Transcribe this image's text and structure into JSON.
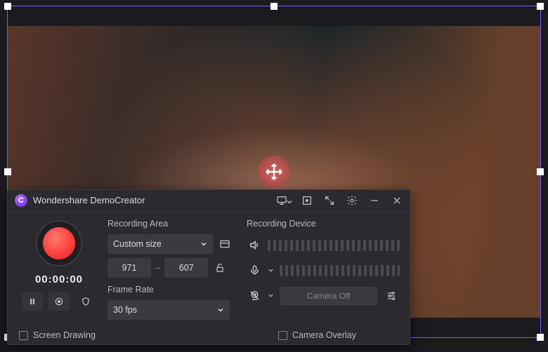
{
  "app": {
    "title": "Wondershare DemoCreator"
  },
  "record": {
    "timer": "00:00:00"
  },
  "recording_area": {
    "label": "Recording Area",
    "preset": "Custom size",
    "width": "971",
    "height": "607"
  },
  "frame_rate": {
    "label": "Frame Rate",
    "value": "30 fps"
  },
  "recording_device": {
    "label": "Recording Device",
    "camera_status": "Camera Off"
  },
  "footer": {
    "screen_drawing": "Screen Drawing",
    "camera_overlay": "Camera Overlay"
  }
}
